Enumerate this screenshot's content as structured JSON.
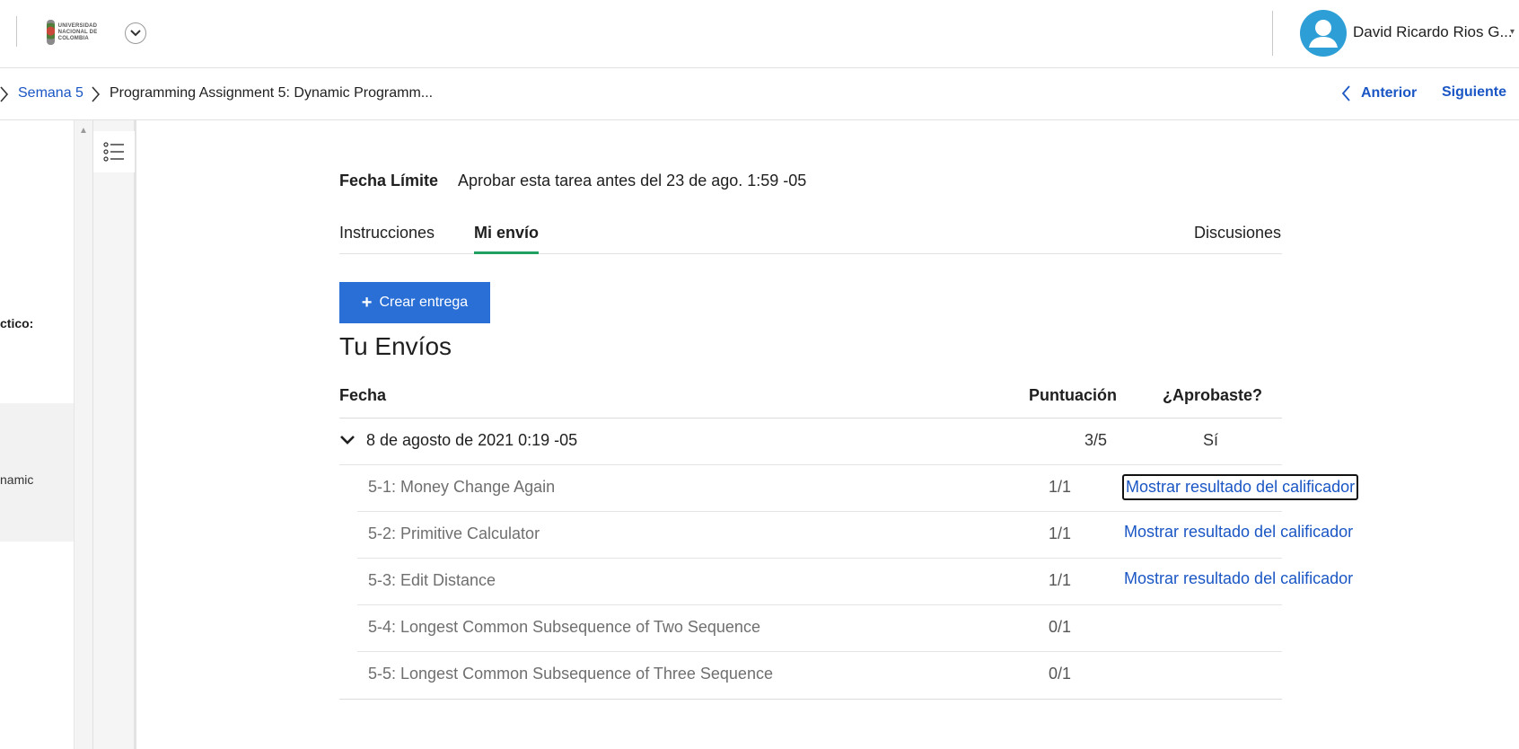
{
  "header": {
    "logo_alt": "UNIVERSIDAD NACIONAL DE COLOMBIA",
    "user_name": "David Ricardo Rios G..."
  },
  "breadcrumb": {
    "week": "Semana 5",
    "current": "Programming Assignment 5: Dynamic Programm...",
    "prev_label": "Anterior",
    "next_label": "Siguiente"
  },
  "sidebar": {
    "item_partial_1": "ctico:",
    "item_partial_2": "namic"
  },
  "assignment": {
    "due_label": "Fecha Límite",
    "due_text": "Aprobar esta tarea antes del 23 de ago. 1:59 -05",
    "tabs": [
      "Instrucciones",
      "Mi envío",
      "Discusiones"
    ],
    "active_tab": "Mi envío",
    "create_button": "Crear entrega",
    "submissions_title": "Tu Envíos"
  },
  "table": {
    "headers": {
      "date": "Fecha",
      "score": "Puntuación",
      "passed": "¿Aprobaste?"
    },
    "submission": {
      "date": "8 de agosto de 2021 0:19 -05",
      "score": "3/5",
      "passed": "Sí"
    },
    "items": [
      {
        "name": "5-1: Money Change Again",
        "score": "1/1",
        "link": "Mostrar resultado del calificador"
      },
      {
        "name": "5-2: Primitive Calculator",
        "score": "1/1",
        "link": "Mostrar resultado del calificador"
      },
      {
        "name": "5-3: Edit Distance",
        "score": "1/1",
        "link": "Mostrar resultado del calificador"
      },
      {
        "name": "5-4: Longest Common Subsequence of Two Sequence",
        "score": "0/1",
        "link": ""
      },
      {
        "name": "5-5: Longest Common Subsequence of Three Sequence",
        "score": "0/1",
        "link": ""
      }
    ]
  },
  "colors": {
    "accent": "#2a6fd6",
    "link": "#1a56c4",
    "tab_underline": "#1fa060",
    "avatar": "#2e9fd6"
  }
}
